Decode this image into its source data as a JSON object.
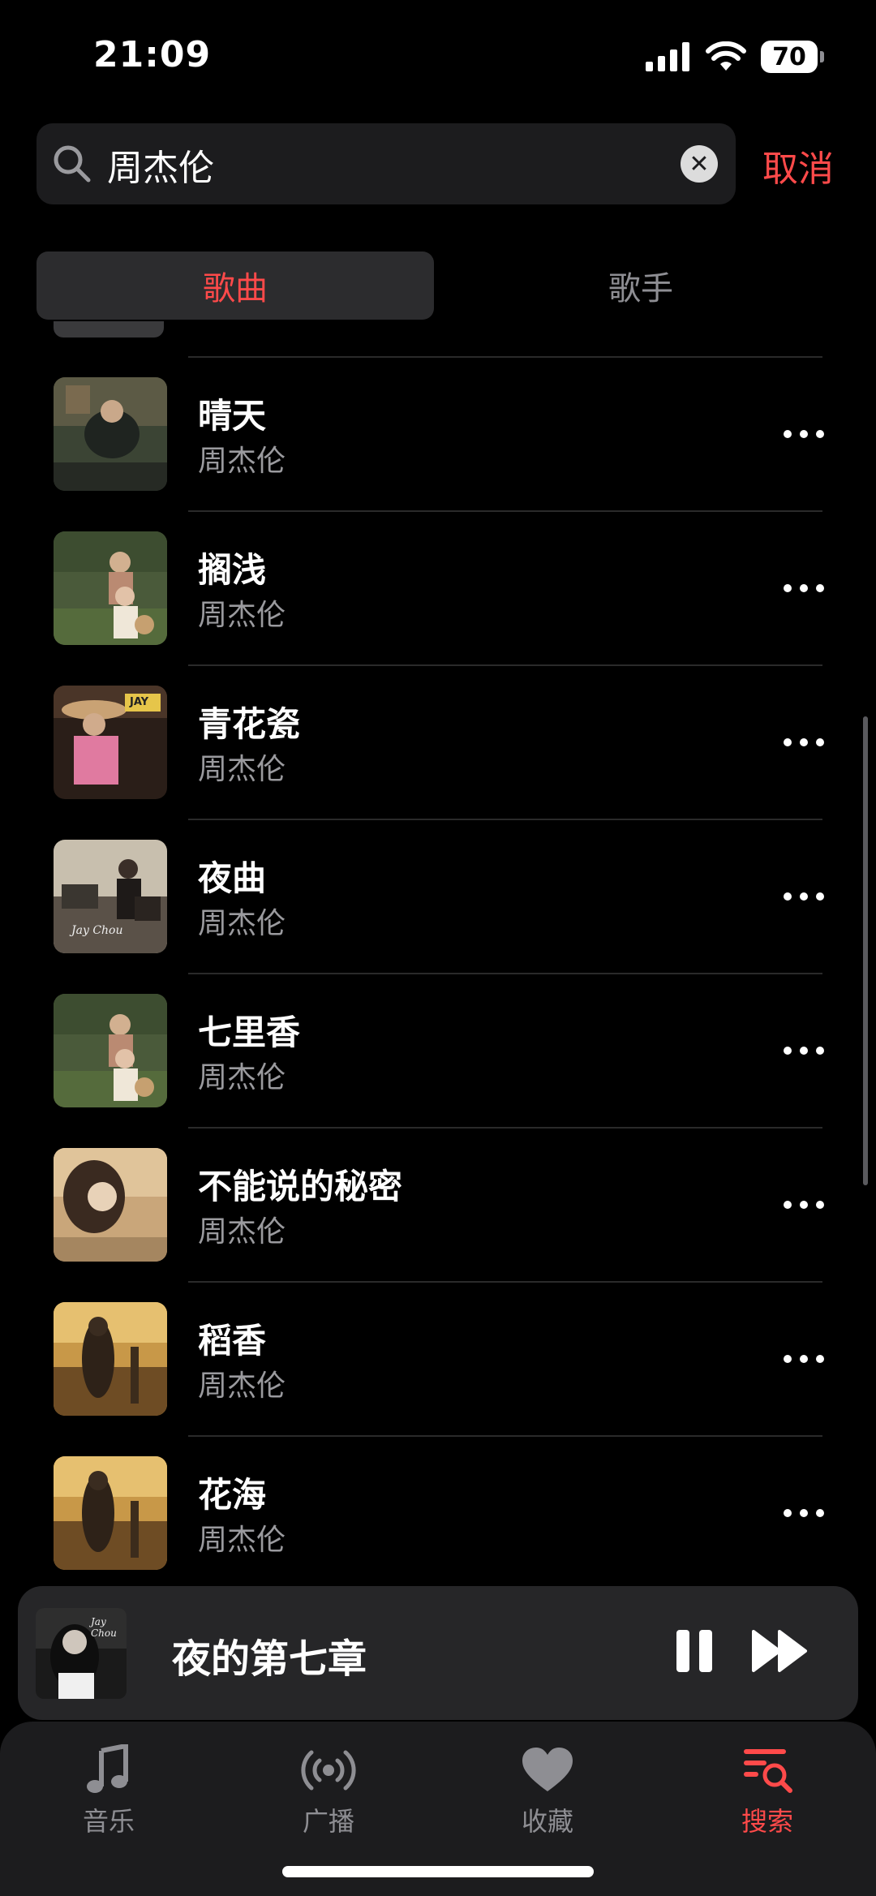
{
  "status_bar": {
    "time": "21:09",
    "battery": "70"
  },
  "search": {
    "query": "周杰伦",
    "placeholder": "",
    "cancel_label": "取消"
  },
  "segments": {
    "songs": "歌曲",
    "artists": "歌手"
  },
  "songs": [
    {
      "title": "晴天",
      "artist": "周杰伦"
    },
    {
      "title": "搁浅",
      "artist": "周杰伦"
    },
    {
      "title": "青花瓷",
      "artist": "周杰伦"
    },
    {
      "title": "夜曲",
      "artist": "周杰伦"
    },
    {
      "title": "七里香",
      "artist": "周杰伦"
    },
    {
      "title": "不能说的秘密",
      "artist": "周杰伦"
    },
    {
      "title": "稻香",
      "artist": "周杰伦"
    },
    {
      "title": "花海",
      "artist": "周杰伦"
    }
  ],
  "cover_text": {
    "jay": "JAY",
    "jay_chou": "Jay Chou"
  },
  "now_playing": {
    "title": "夜的第七章"
  },
  "tabs": [
    {
      "label": "音乐",
      "icon": "music-note-icon"
    },
    {
      "label": "广播",
      "icon": "broadcast-icon"
    },
    {
      "label": "收藏",
      "icon": "heart-icon"
    },
    {
      "label": "搜索",
      "icon": "search-list-icon"
    }
  ],
  "colors": {
    "accent": "#ff4a4a",
    "background": "#000000",
    "secondary_text": "#9a9a9e"
  }
}
